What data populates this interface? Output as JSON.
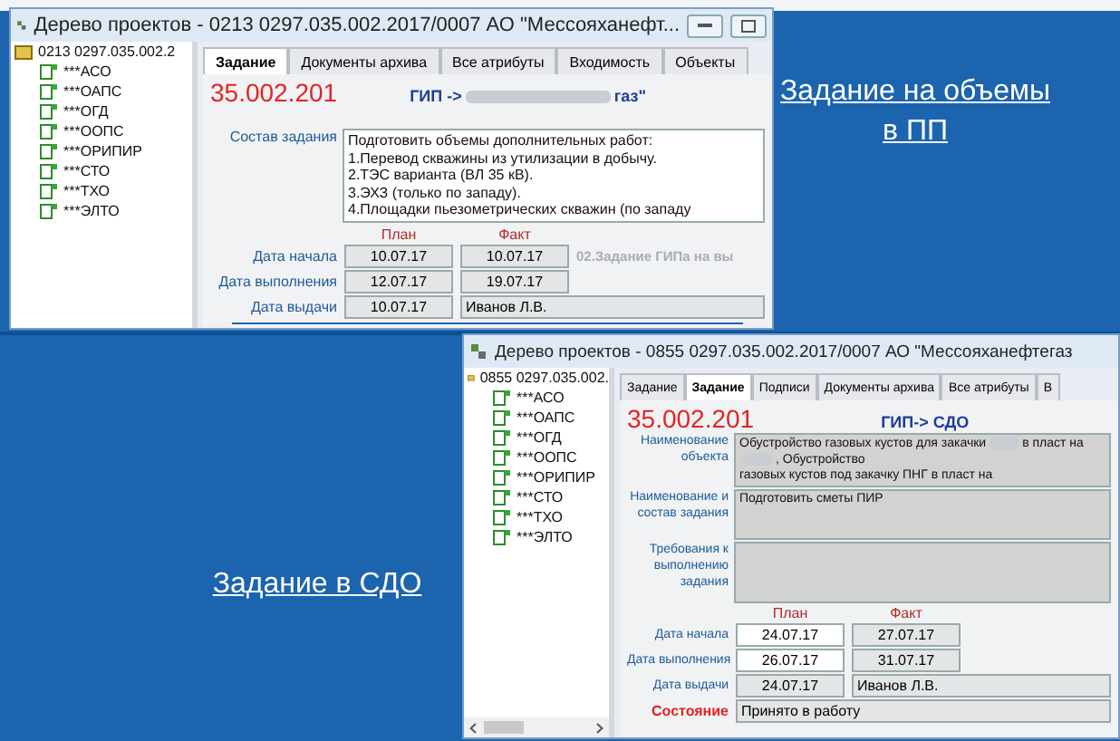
{
  "windows": [
    {
      "title": "Дерево проектов - 0213 0297.035.002.2017/0007 АО \"Мессояханефт...",
      "window_buttons": true,
      "tree": {
        "root": "0213 0297.035.002.2",
        "children": [
          "***АСО",
          "***ОАПС",
          "***ОГД",
          "***ООПС",
          "***ОРИПИР",
          "***СТО",
          "***ТХО",
          "***ЭЛТО"
        ],
        "scrollbar": false
      },
      "tabs": [
        {
          "label": "Задание",
          "selected": true
        },
        {
          "label": "Документы архива",
          "selected": false
        },
        {
          "label": "Все атрибуты",
          "selected": false
        },
        {
          "label": "Входимость",
          "selected": false
        },
        {
          "label": "Объекты",
          "selected": false
        }
      ],
      "code": "35.002.201",
      "header": [
        {
          "kind": "text",
          "text": "ГИП ->"
        },
        {
          "kind": "redacted"
        },
        {
          "kind": "text",
          "text": "газ\""
        }
      ],
      "fields": [
        {
          "label": "Состав задания",
          "kind": "white",
          "lines": [
            [
              {
                "kind": "text",
                "text": "Подготовить объемы дополнительных работ:"
              }
            ],
            [
              {
                "kind": "text",
                "text": "1.Перевод скважины из утилизации в добычу."
              }
            ],
            [
              {
                "kind": "text",
                "text": "2.ТЭС варианта (ВЛ 35 кВ)."
              }
            ],
            [
              {
                "kind": "text",
                "text": "3.ЭХЗ (только по западу)."
              }
            ],
            [
              {
                "kind": "text",
                "text": "4.Площадки пьезометрических скважин (по западу"
              }
            ]
          ]
        }
      ],
      "plan_label": "План",
      "fact_label": "Факт",
      "note": "02.Задание ГИПа на вы",
      "dates": [
        {
          "label": "Дата начала",
          "plan": "10.07.17",
          "fact": "10.07.17",
          "editable": false
        },
        {
          "label": "Дата выполнения",
          "plan": "12.07.17",
          "fact": "19.07.17",
          "editable": false
        },
        {
          "label": "Дата выдачи",
          "plan": "10.07.17",
          "fact": "Иванов Л.В.",
          "editable": false
        }
      ]
    },
    {
      "title": "Дерево проектов - 0855 0297.035.002.2017/0007 АО \"Мессояханефтегаз",
      "window_buttons": false,
      "tree": {
        "root": "0855 0297.035.002.",
        "children": [
          "***АСО",
          "***ОАПС",
          "***ОГД",
          "***ООПС",
          "***ОРИПИР",
          "***СТО",
          "***ТХО",
          "***ЭЛТО"
        ],
        "scrollbar": true
      },
      "tabs": [
        {
          "label": "Задание",
          "selected": false
        },
        {
          "label": "Задание",
          "selected": true
        },
        {
          "label": "Подписи",
          "selected": false
        },
        {
          "label": "Документы архива",
          "selected": false
        },
        {
          "label": "Все атрибуты",
          "selected": false
        },
        {
          "label": "В",
          "selected": false
        }
      ],
      "code": "35.002.201",
      "header": [
        {
          "kind": "text",
          "text": "ГИП-> СДО"
        }
      ],
      "fields": [
        {
          "label": "Наименование объекта",
          "kind": "grey",
          "lines": [
            [
              {
                "kind": "text",
                "text": "Обустройство газовых кустов для закачки"
              },
              {
                "kind": "redacted"
              },
              {
                "kind": "text",
                "text": "в пласт на"
              }
            ],
            [
              {
                "kind": "redacted"
              },
              {
                "kind": "text",
                "text": ", Обустройство"
              }
            ],
            [
              {
                "kind": "text",
                "text": "газовых кустов под закачку ПНГ в пласт на"
              }
            ]
          ]
        },
        {
          "label": "Наименование и состав задания",
          "kind": "mid",
          "lines": [
            [
              {
                "kind": "text",
                "text": "Подготовить сметы ПИР"
              }
            ]
          ]
        },
        {
          "label": "Требования к выполнению задания",
          "kind": "tall"
        }
      ],
      "plan_label": "План",
      "fact_label": "Факт",
      "dates": [
        {
          "label": "Дата начала",
          "plan": "24.07.17",
          "fact": "27.07.17",
          "editable": true
        },
        {
          "label": "Дата выполнения",
          "plan": "26.07.17",
          "fact": "31.07.17",
          "editable": true
        },
        {
          "label": "Дата выдачи",
          "plan": "24.07.17",
          "fact": "Иванов Л.В.",
          "editable": false
        }
      ],
      "status": {
        "label": "Состояние",
        "value": "Принято в работу"
      }
    }
  ],
  "captions": [
    "Задание на объемы в ПП",
    "Задание в СДО"
  ]
}
